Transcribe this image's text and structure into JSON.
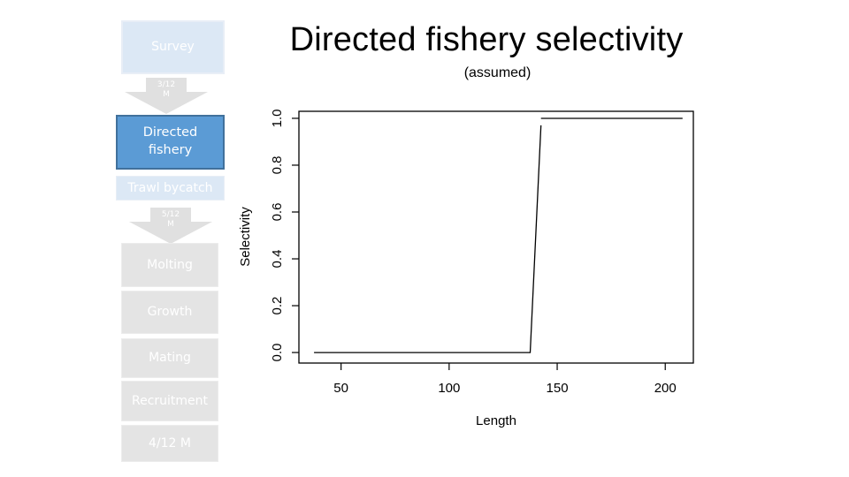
{
  "slide": {
    "title": "Directed fishery selectivity",
    "subtitle": "(assumed)"
  },
  "flow": {
    "colors": {
      "inactive_blue": "#dce8f5",
      "active_blue": "#5b9bd5",
      "active_border": "#41719c",
      "inactive_grey": "#e4e4e4",
      "arrow": "#e0e0e0"
    },
    "steps": [
      {
        "label": "Survey",
        "state": "inactive"
      },
      {
        "label": "3/12\nM",
        "type": "arrow"
      },
      {
        "label": "Directed\nfishery",
        "state": "active"
      },
      {
        "label": "Trawl bycatch",
        "state": "inactive"
      },
      {
        "label": "5/12\nM",
        "type": "arrow"
      },
      {
        "label": "Molting",
        "state": "inactive"
      },
      {
        "label": "Growth",
        "state": "inactive"
      },
      {
        "label": "Mating",
        "state": "inactive"
      },
      {
        "label": "Recruitment",
        "state": "inactive"
      },
      {
        "label": "4/12 M",
        "state": "inactive"
      }
    ],
    "survey": "Survey",
    "arrow1_line1": "3/12",
    "arrow1_line2": "M",
    "directed_line1": "Directed",
    "directed_line2": "fishery",
    "trawl": "Trawl bycatch",
    "arrow2_line1": "5/12",
    "arrow2_line2": "M",
    "molting": "Molting",
    "growth": "Growth",
    "mating": "Mating",
    "recruitment": "Recruitment",
    "final_m": "4/12 M"
  },
  "chart_data": {
    "type": "line",
    "title": "",
    "xlabel": "Length",
    "ylabel": "Selectivity",
    "xlim": [
      30.5,
      213
    ],
    "ylim": [
      -0.045,
      1.03
    ],
    "xticks": [
      50,
      100,
      150,
      200
    ],
    "xtick_labels": [
      "50",
      "100",
      "150",
      "200"
    ],
    "yticks": [
      0.0,
      0.2,
      0.4,
      0.6,
      0.8,
      1.0
    ],
    "ytick_labels": [
      "0.0",
      "0.2",
      "0.4",
      "0.6",
      "0.8",
      "1.0"
    ],
    "grid": false,
    "legend": "none",
    "series": [
      {
        "name": "selectivity",
        "segments": [
          {
            "x": [
              37.5,
              137.5,
              142.5
            ],
            "y": [
              0.0,
              0.0,
              0.97
            ]
          },
          {
            "x": [
              142.5,
              208
            ],
            "y": [
              1.0,
              1.0
            ]
          }
        ]
      }
    ]
  }
}
